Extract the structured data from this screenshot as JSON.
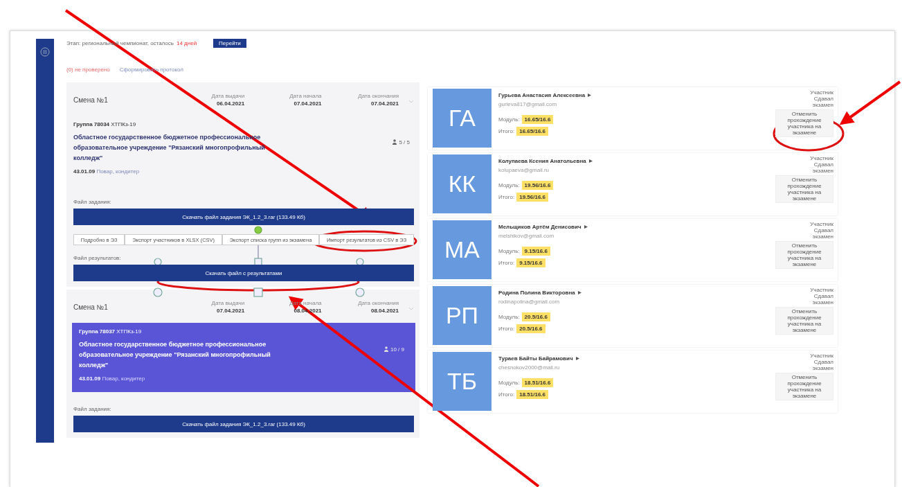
{
  "top_bar": {
    "text": "Этап: региональный чемпионат, осталось",
    "deadline": "14 дней",
    "button": "Перейти"
  },
  "links": [
    {
      "kind": "alert",
      "label": "(0) не проверено"
    },
    {
      "kind": "action",
      "label": "Сформировать протокол"
    }
  ],
  "shifts": [
    {
      "title": "Смена №1",
      "dates": [
        {
          "label": "Дата выдачи",
          "value": "06.04.2021"
        },
        {
          "label": "Дата начала",
          "value": "07.04.2021"
        },
        {
          "label": "Дата окончания",
          "value": "07.04.2021"
        }
      ],
      "group": {
        "name": "Группа 78034",
        "code": "ХТПКз-19",
        "org": "Областное государственное бюджетное профессиональное образовательное учреждение \"Рязанский многопрофильный колледж\"",
        "spec_code": "43.01.09",
        "spec": "Повар, кондитер",
        "count": "5 / 5",
        "selected": false
      },
      "task_label": "Файл задания:",
      "task_button": "Скачать файл задания ЭК_1.2_3.rar (133.49 Кб)",
      "tabs": [
        "Подробно в ЭЗ",
        "Экспорт участников в XLSX (CSV)",
        "Экспорт списка групп из экзамена",
        "Импорт результатов из CSV в ЭЗ"
      ],
      "result_label": "Файл результатов:",
      "result_button": "Скачать файл с результатами"
    },
    {
      "title": "Смена №1",
      "dates": [
        {
          "label": "Дата выдачи",
          "value": "07.04.2021"
        },
        {
          "label": "Дата начала",
          "value": "08.04.2021"
        },
        {
          "label": "Дата окончания",
          "value": "08.04.2021"
        }
      ],
      "group": {
        "name": "Группа 78037",
        "code": "ХТПКз-19",
        "org": "Областное государственное бюджетное профессиональное образовательное учреждение \"Рязанский многопрофильный колледж\"",
        "spec_code": "43.01.09",
        "spec": "Повар, кондитер",
        "count": "10 / 9",
        "selected": true
      },
      "task_label": "Файл задания:",
      "task_button": "Скачать файл задания ЭК_1.2_3.rar (133.49 Кб)"
    }
  ],
  "participants": [
    {
      "initials": "ГА",
      "name": "Гурьева Анастасия Алексеевна",
      "email": "gurieva817@gmail.com",
      "scores": [
        {
          "label": "Модуль:",
          "value": "16.65/16.6"
        },
        {
          "label": "Итого:",
          "value": "16.65/16.6"
        }
      ],
      "status": [
        "Участник",
        "Сдавал",
        "экзамен"
      ],
      "action": "Отменить прохождение участника на экзамене"
    },
    {
      "initials": "КК",
      "name": "Колупаева Ксения Анатольевна",
      "email": "kolupaeva@gmail.ru",
      "scores": [
        {
          "label": "Модуль:",
          "value": "19.56/16.6"
        },
        {
          "label": "Итого:",
          "value": "19.56/16.6"
        }
      ],
      "status": [
        "Участник",
        "Сдавал",
        "экзамен"
      ],
      "action": "Отменить прохождение участника на экзамене"
    },
    {
      "initials": "МА",
      "name": "Мельщиков Артём Денисович",
      "email": "melshikov@gmail.com",
      "scores": [
        {
          "label": "Модуль:",
          "value": "9.15/16.6"
        },
        {
          "label": "Итого:",
          "value": "9.15/16.6"
        }
      ],
      "status": [
        "Участник",
        "Сдавал",
        "экзамен"
      ],
      "action": "Отменить прохождение участника на экзамене"
    },
    {
      "initials": "РП",
      "name": "Родина Полина Викторовна",
      "email": "rodinapolina@gmail.com",
      "scores": [
        {
          "label": "Модуль:",
          "value": "20.5/16.6"
        },
        {
          "label": "Итого:",
          "value": "20.5/16.6"
        }
      ],
      "status": [
        "Участник",
        "Сдавал",
        "экзамен"
      ],
      "action": "Отменить прохождение участника на экзамене"
    },
    {
      "initials": "ТБ",
      "name": "Тураев Байты Байрамович",
      "email": "chesnokov2000@mail.ru",
      "scores": [
        {
          "label": "Модуль:",
          "value": "18.51/16.6"
        },
        {
          "label": "Итого:",
          "value": "18.51/16.6"
        }
      ],
      "status": [
        "Участник",
        "Сдавал",
        "экзамен"
      ],
      "action": "Отменить прохождение участника на экзамене"
    }
  ]
}
